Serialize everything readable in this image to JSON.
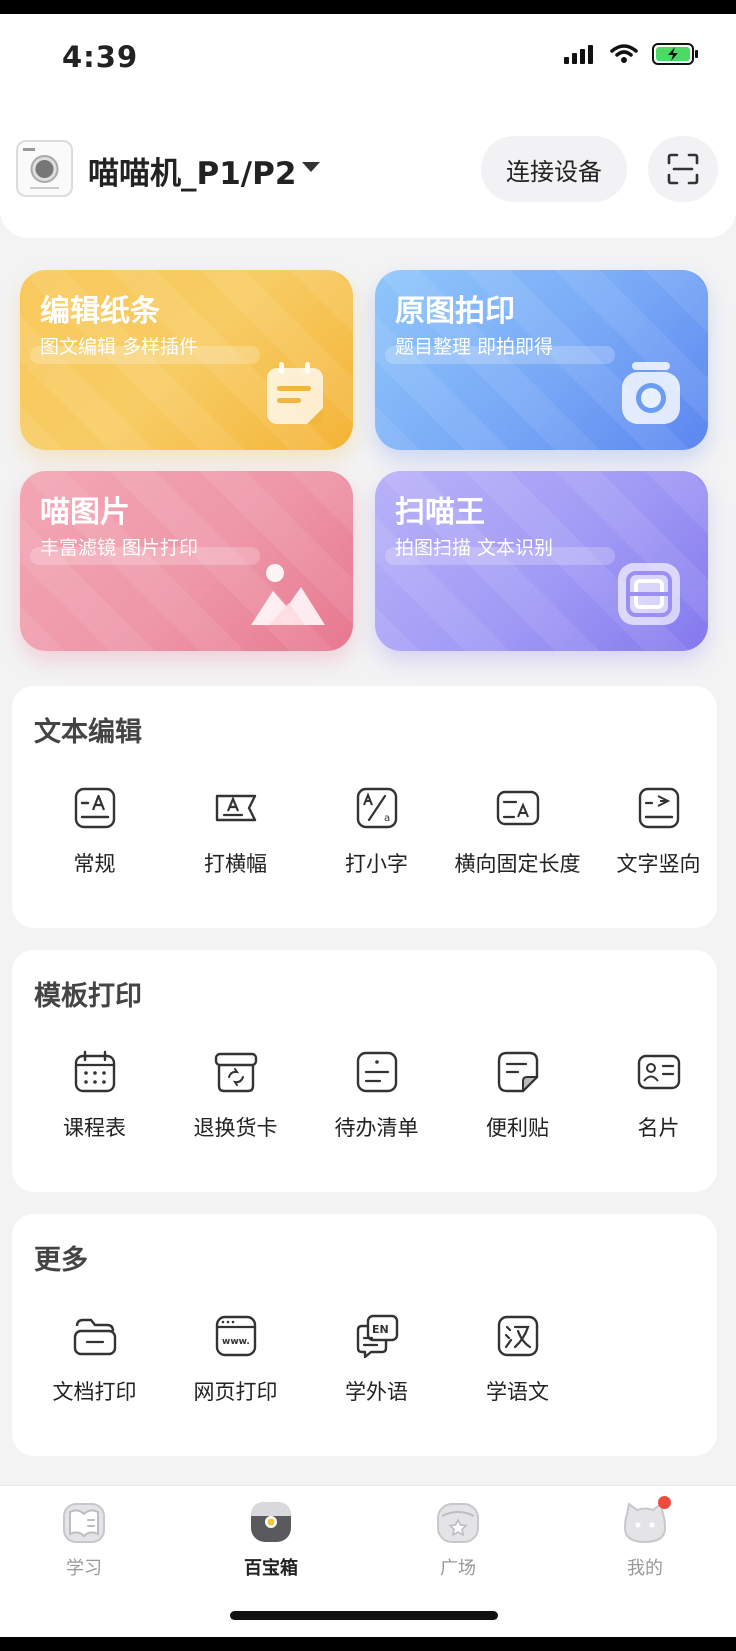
{
  "status_bar": {
    "time": "4:39"
  },
  "header": {
    "device_name": "喵喵机_P1/P2",
    "connect_label": "连接设备",
    "scan_icon": "scan-icon"
  },
  "cards": [
    {
      "title": "编辑纸条",
      "subtitle": "图文编辑 多样插件",
      "icon": "note-icon"
    },
    {
      "title": "原图拍印",
      "subtitle": "题目整理 即拍即得",
      "icon": "camera-icon"
    },
    {
      "title": "喵图片",
      "subtitle": "丰富滤镜 图片打印",
      "icon": "image-icon"
    },
    {
      "title": "扫喵王",
      "subtitle": "拍图扫描 文本识别",
      "icon": "ocr-icon"
    }
  ],
  "sections": {
    "text_edit": {
      "title": "文本编辑",
      "items": [
        {
          "label": "常规"
        },
        {
          "label": "打横幅"
        },
        {
          "label": "打小字"
        },
        {
          "label": "横向固定长度"
        },
        {
          "label": "文字竖向"
        }
      ]
    },
    "template_print": {
      "title": "模板打印",
      "items": [
        {
          "label": "课程表"
        },
        {
          "label": "退换货卡"
        },
        {
          "label": "待办清单"
        },
        {
          "label": "便利贴"
        },
        {
          "label": "名片"
        }
      ]
    },
    "more": {
      "title": "更多",
      "items": [
        {
          "label": "文档打印"
        },
        {
          "label": "网页打印"
        },
        {
          "label": "学外语"
        },
        {
          "label": "学语文"
        }
      ]
    }
  },
  "bottom_nav": {
    "items": [
      {
        "label": "学习",
        "active": false
      },
      {
        "label": "百宝箱",
        "active": true
      },
      {
        "label": "广场",
        "active": false
      },
      {
        "label": "我的",
        "active": false
      }
    ]
  },
  "colors": {
    "accent_yellow": "#f6c04b",
    "accent_blue": "#6f9ff5",
    "accent_pink": "#ec8ea1",
    "accent_purple": "#9a90f3",
    "badge_red": "#f04a3c"
  }
}
